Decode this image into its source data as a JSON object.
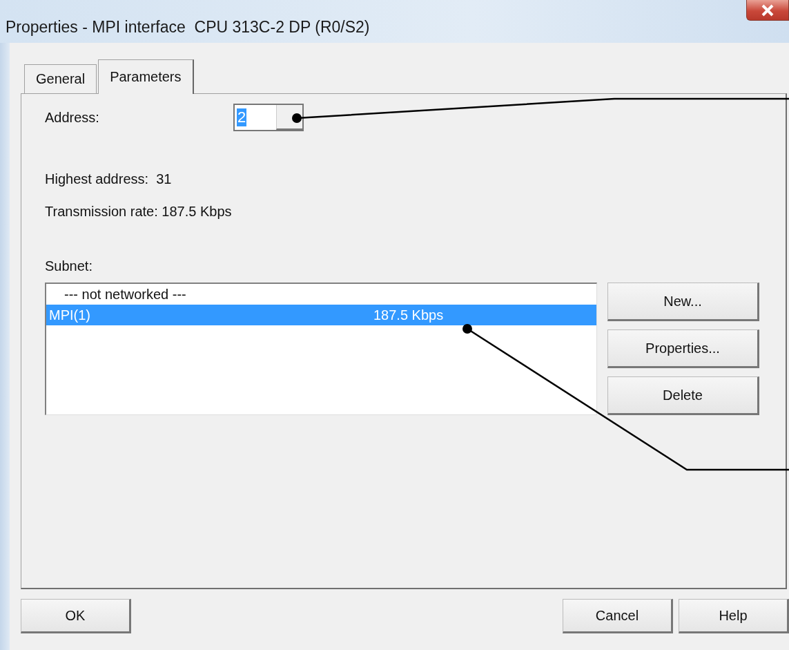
{
  "window": {
    "title": "Properties - MPI interface  CPU 313C-2 DP (R0/S2)"
  },
  "tabs": [
    {
      "label": "General",
      "selected": false
    },
    {
      "label": "Parameters",
      "selected": true
    }
  ],
  "address": {
    "label": "Address:",
    "value": "2"
  },
  "highest_address": "Highest address:  31",
  "transmission_rate": "Transmission rate: 187.5 Kbps",
  "subnet": {
    "label": "Subnet:",
    "items": [
      {
        "name": "--- not networked ---",
        "selected": false
      },
      {
        "name": "MPI(1)",
        "rate": "187.5 Kbps",
        "selected": true
      }
    ]
  },
  "subnet_buttons": [
    "New...",
    "Properties...",
    "Delete"
  ],
  "footer_buttons": {
    "left": [
      "OK"
    ],
    "right": [
      "Cancel",
      "Help"
    ]
  }
}
